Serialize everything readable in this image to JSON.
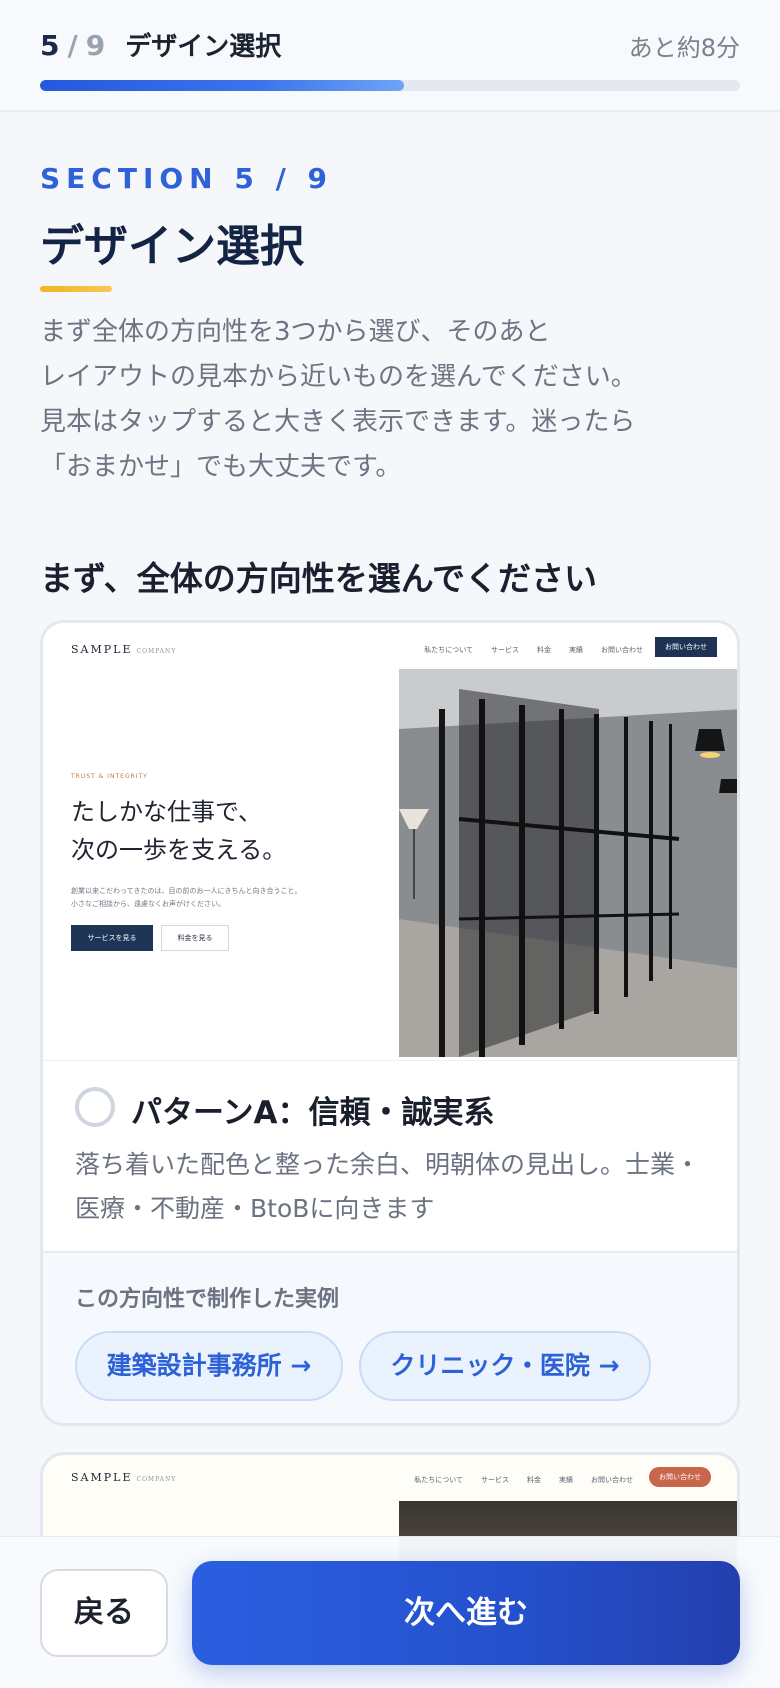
{
  "header": {
    "step_current": "5",
    "step_sep": "/",
    "step_total": "9",
    "step_title": "デザイン選択",
    "time_remaining": "あと約8分",
    "progress": 0.52,
    "progress_color": "#2f62d8"
  },
  "section": {
    "label": "SECTION 5 / 9",
    "title": "デザイン選択",
    "accent_color": "#f4b322",
    "intro": "まず全体の方向性を3つから選び、そのあと\nレイアウトの見本から近いものを選んでください。\n見本はタップすると大きく表示できます。迷ったら\n「おまかせ」でも大丈夫です。",
    "question": "まず、全体の方向性を選んでください"
  },
  "option_a": {
    "preview": {
      "logo": "SAMPLE",
      "logo_sub": "COMPANY",
      "nav": [
        "私たちについて",
        "サービス",
        "料金",
        "実績",
        "お問い合わせ"
      ],
      "cta": "お問い合わせ",
      "eyebrow": "TRUST & INTEGRITY",
      "headline": "たしかな仕事で、\n次の一歩を支える。",
      "body": "創業以来こだわってきたのは、目の前のお一人にきちんと向き合うこと。\n小さなご相談から、遠慮なくお声がけください。",
      "btn_primary": "サービスを見る",
      "btn_secondary": "料金を見る"
    },
    "title": "パターンA：信頼・誠実系",
    "description": "落ち着いた配色と整った余白、明朝体の見出し。士業・医療・不動産・BtoBに向きます",
    "selected": false,
    "examples_label": "この方向性で制作した実例",
    "examples": [
      {
        "label": "建築設計事務所 →"
      },
      {
        "label": "クリニック・医院 →"
      }
    ]
  },
  "option_b_peek": {
    "logo": "SAMPLE",
    "logo_sub": "COMPANY",
    "nav": [
      "私たちについて",
      "サービス",
      "料金",
      "実績",
      "お問い合わせ"
    ],
    "cta": "お問い合わせ"
  },
  "footer": {
    "back_label": "戻る",
    "next_label": "次へ進む"
  }
}
